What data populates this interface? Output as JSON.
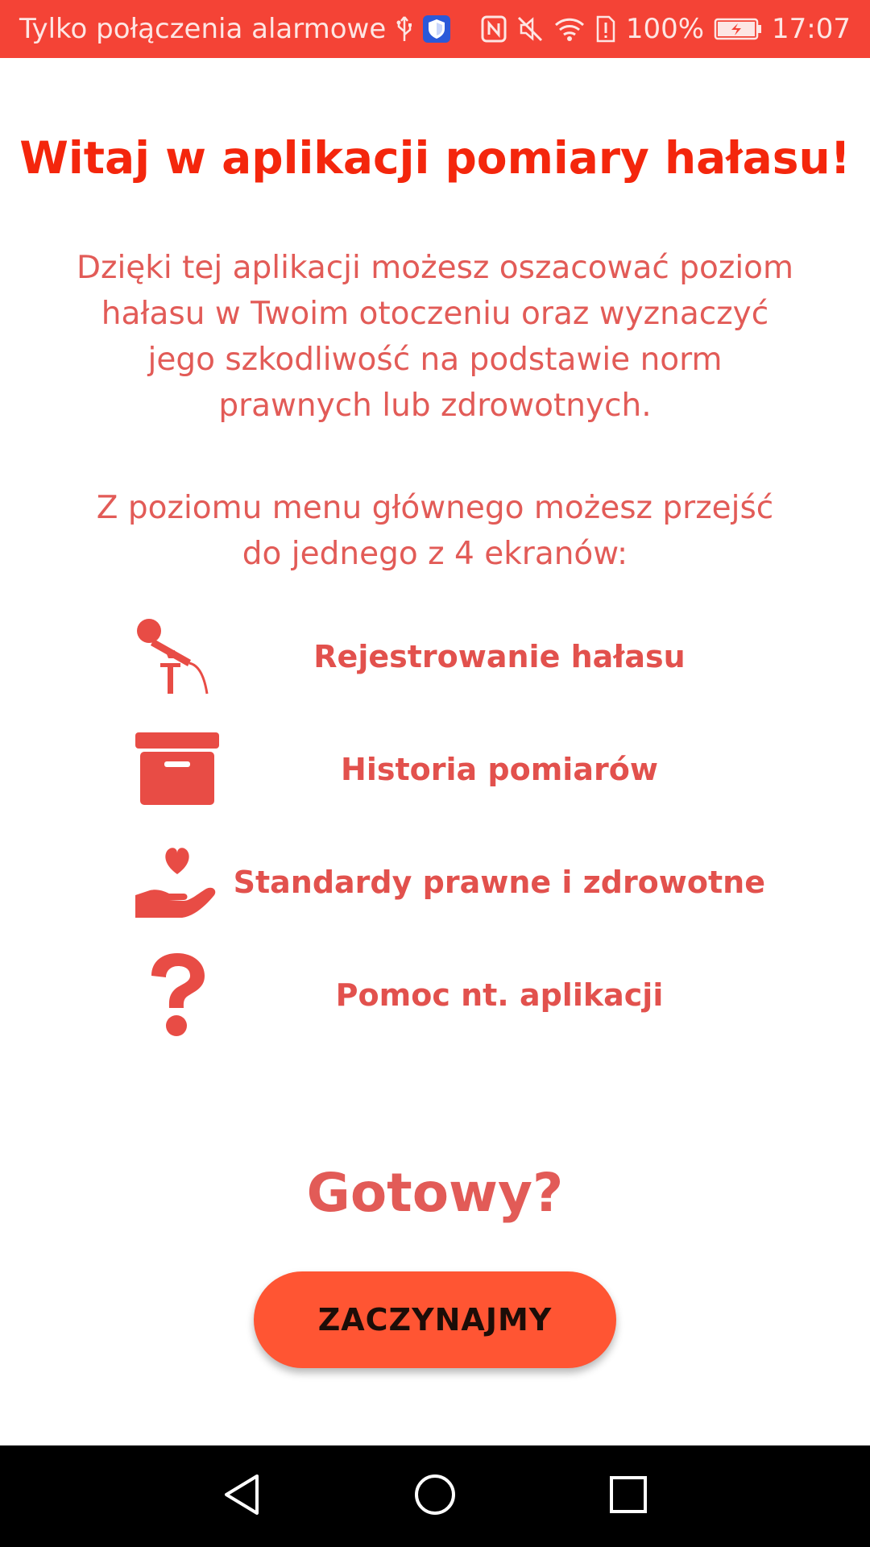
{
  "status_bar": {
    "carrier_text": "Tylko połączenia alarmowe",
    "battery_percent": "100%",
    "time": "17:07",
    "left_icons": [
      "usb-icon",
      "shield-app-icon"
    ],
    "right_icons": [
      "nfc-icon",
      "mute-icon",
      "wifi-icon",
      "alert-sim-icon",
      "battery-charging-icon"
    ]
  },
  "welcome": {
    "title": "Witaj w aplikacji pomiary hałasu!",
    "intro_lines": [
      "Dzięki tej aplikacji możesz oszacować poziom",
      "hałasu w Twoim otoczeniu oraz wyznaczyć",
      "jego szkodliwość na podstawie norm",
      "prawnych lub zdrowotnych."
    ],
    "menu_hint_lines": [
      "Z poziomu menu głównego możesz przejść",
      "do jednego z 4 ekranów:"
    ]
  },
  "features": [
    {
      "icon": "microphone-icon",
      "label": "Rejestrowanie hałasu"
    },
    {
      "icon": "archive-box-icon",
      "label": "Historia pomiarów"
    },
    {
      "icon": "hand-heart-icon",
      "label": "Standardy prawne i zdrowotne"
    },
    {
      "icon": "question-mark-icon",
      "label": "Pomoc nt. aplikacji"
    }
  ],
  "cta": {
    "ready_text": "Gotowy?",
    "start_button_label": "ZACZYNAJMY"
  },
  "nav_bar": {
    "buttons": [
      "back-icon",
      "home-icon",
      "recents-icon"
    ]
  },
  "colors": {
    "status_bar": "#f44336",
    "title": "#f4260c",
    "body_text": "#e25b57",
    "button": "#ff5533",
    "button_text": "#1c0d08",
    "nav_bar": "#000000"
  }
}
